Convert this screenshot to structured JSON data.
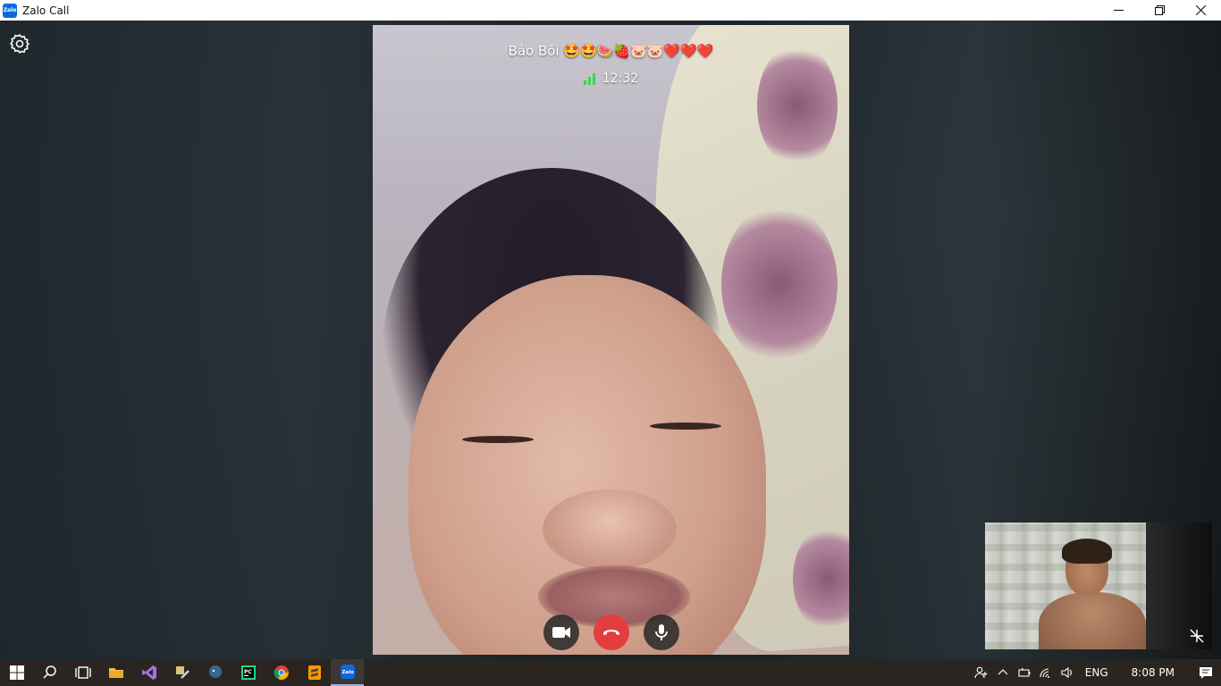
{
  "window": {
    "title": "Zalo Call",
    "icon_label": "Zalo"
  },
  "call": {
    "callee_name": "Bảo Bối 🤩🤩🍉🍓🐷🐷❤️❤️❤️",
    "duration": "12:32",
    "signal_bars": 3
  },
  "controls": {
    "icons": [
      "camera-icon",
      "end-call-icon",
      "microphone-icon"
    ]
  },
  "taskbar": {
    "apps": [
      "start-icon",
      "search-icon",
      "task-view-icon",
      "file-explorer-icon",
      "visual-studio-icon",
      "tools-icon",
      "postgres-icon",
      "pycharm-icon",
      "chrome-icon",
      "sublime-icon",
      "zalo-icon"
    ],
    "pycharm_label": "PC",
    "zalo_label": "Zalo",
    "language": "ENG",
    "time": "8:08 PM"
  },
  "colors": {
    "end_call": "#e43d3d",
    "signal": "#3cd44c",
    "taskbar": "#2a2520"
  }
}
